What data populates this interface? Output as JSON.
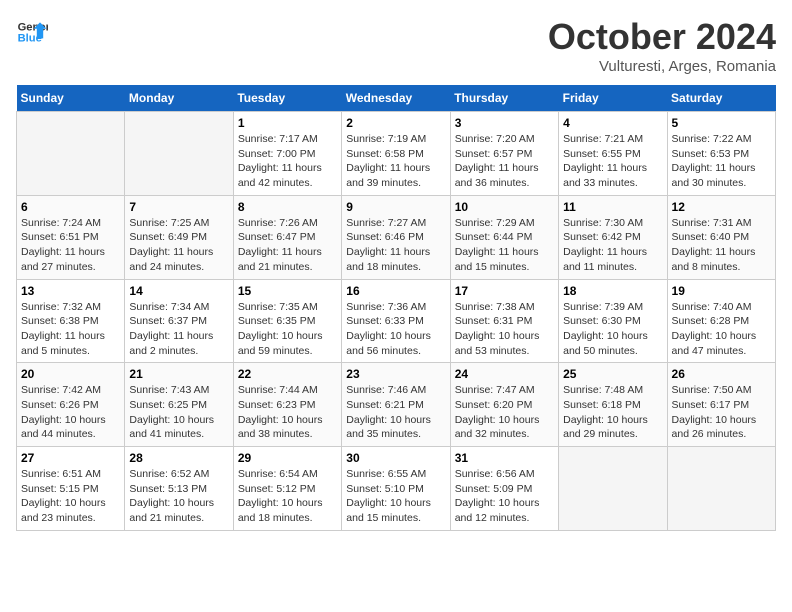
{
  "header": {
    "logo_line1": "General",
    "logo_line2": "Blue",
    "month_title": "October 2024",
    "location": "Vulturesti, Arges, Romania"
  },
  "weekdays": [
    "Sunday",
    "Monday",
    "Tuesday",
    "Wednesday",
    "Thursday",
    "Friday",
    "Saturday"
  ],
  "weeks": [
    [
      {
        "num": "",
        "empty": true
      },
      {
        "num": "",
        "empty": true
      },
      {
        "num": "1",
        "sunrise": "7:17 AM",
        "sunset": "7:00 PM",
        "daylight": "11 hours and 42 minutes."
      },
      {
        "num": "2",
        "sunrise": "7:19 AM",
        "sunset": "6:58 PM",
        "daylight": "11 hours and 39 minutes."
      },
      {
        "num": "3",
        "sunrise": "7:20 AM",
        "sunset": "6:57 PM",
        "daylight": "11 hours and 36 minutes."
      },
      {
        "num": "4",
        "sunrise": "7:21 AM",
        "sunset": "6:55 PM",
        "daylight": "11 hours and 33 minutes."
      },
      {
        "num": "5",
        "sunrise": "7:22 AM",
        "sunset": "6:53 PM",
        "daylight": "11 hours and 30 minutes."
      }
    ],
    [
      {
        "num": "6",
        "sunrise": "7:24 AM",
        "sunset": "6:51 PM",
        "daylight": "11 hours and 27 minutes."
      },
      {
        "num": "7",
        "sunrise": "7:25 AM",
        "sunset": "6:49 PM",
        "daylight": "11 hours and 24 minutes."
      },
      {
        "num": "8",
        "sunrise": "7:26 AM",
        "sunset": "6:47 PM",
        "daylight": "11 hours and 21 minutes."
      },
      {
        "num": "9",
        "sunrise": "7:27 AM",
        "sunset": "6:46 PM",
        "daylight": "11 hours and 18 minutes."
      },
      {
        "num": "10",
        "sunrise": "7:29 AM",
        "sunset": "6:44 PM",
        "daylight": "11 hours and 15 minutes."
      },
      {
        "num": "11",
        "sunrise": "7:30 AM",
        "sunset": "6:42 PM",
        "daylight": "11 hours and 11 minutes."
      },
      {
        "num": "12",
        "sunrise": "7:31 AM",
        "sunset": "6:40 PM",
        "daylight": "11 hours and 8 minutes."
      }
    ],
    [
      {
        "num": "13",
        "sunrise": "7:32 AM",
        "sunset": "6:38 PM",
        "daylight": "11 hours and 5 minutes."
      },
      {
        "num": "14",
        "sunrise": "7:34 AM",
        "sunset": "6:37 PM",
        "daylight": "11 hours and 2 minutes."
      },
      {
        "num": "15",
        "sunrise": "7:35 AM",
        "sunset": "6:35 PM",
        "daylight": "10 hours and 59 minutes."
      },
      {
        "num": "16",
        "sunrise": "7:36 AM",
        "sunset": "6:33 PM",
        "daylight": "10 hours and 56 minutes."
      },
      {
        "num": "17",
        "sunrise": "7:38 AM",
        "sunset": "6:31 PM",
        "daylight": "10 hours and 53 minutes."
      },
      {
        "num": "18",
        "sunrise": "7:39 AM",
        "sunset": "6:30 PM",
        "daylight": "10 hours and 50 minutes."
      },
      {
        "num": "19",
        "sunrise": "7:40 AM",
        "sunset": "6:28 PM",
        "daylight": "10 hours and 47 minutes."
      }
    ],
    [
      {
        "num": "20",
        "sunrise": "7:42 AM",
        "sunset": "6:26 PM",
        "daylight": "10 hours and 44 minutes."
      },
      {
        "num": "21",
        "sunrise": "7:43 AM",
        "sunset": "6:25 PM",
        "daylight": "10 hours and 41 minutes."
      },
      {
        "num": "22",
        "sunrise": "7:44 AM",
        "sunset": "6:23 PM",
        "daylight": "10 hours and 38 minutes."
      },
      {
        "num": "23",
        "sunrise": "7:46 AM",
        "sunset": "6:21 PM",
        "daylight": "10 hours and 35 minutes."
      },
      {
        "num": "24",
        "sunrise": "7:47 AM",
        "sunset": "6:20 PM",
        "daylight": "10 hours and 32 minutes."
      },
      {
        "num": "25",
        "sunrise": "7:48 AM",
        "sunset": "6:18 PM",
        "daylight": "10 hours and 29 minutes."
      },
      {
        "num": "26",
        "sunrise": "7:50 AM",
        "sunset": "6:17 PM",
        "daylight": "10 hours and 26 minutes."
      }
    ],
    [
      {
        "num": "27",
        "sunrise": "6:51 AM",
        "sunset": "5:15 PM",
        "daylight": "10 hours and 23 minutes."
      },
      {
        "num": "28",
        "sunrise": "6:52 AM",
        "sunset": "5:13 PM",
        "daylight": "10 hours and 21 minutes."
      },
      {
        "num": "29",
        "sunrise": "6:54 AM",
        "sunset": "5:12 PM",
        "daylight": "10 hours and 18 minutes."
      },
      {
        "num": "30",
        "sunrise": "6:55 AM",
        "sunset": "5:10 PM",
        "daylight": "10 hours and 15 minutes."
      },
      {
        "num": "31",
        "sunrise": "6:56 AM",
        "sunset": "5:09 PM",
        "daylight": "10 hours and 12 minutes."
      },
      {
        "num": "",
        "empty": true
      },
      {
        "num": "",
        "empty": true
      }
    ]
  ]
}
